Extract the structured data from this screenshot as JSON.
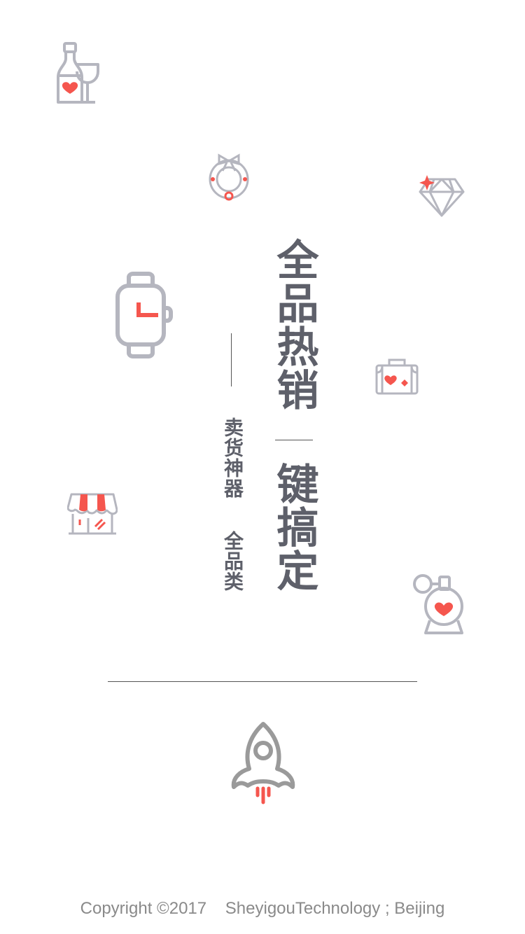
{
  "headline": {
    "part1": "全品热销",
    "part2": "键搞定"
  },
  "subtitle": {
    "part1": "卖货神器",
    "part2": "全品类"
  },
  "footer": {
    "copyright": "Copyright ©2017    SheyigouTechnology ; Beijing"
  },
  "colors": {
    "icon_gray": "#b5b6bf",
    "accent_red": "#f5564e",
    "text_dark": "#5e606a",
    "rocket_gray": "#9a9a9a"
  },
  "icons": [
    "wine-bottle-icon",
    "wreath-icon",
    "diamond-icon",
    "watch-icon",
    "suitcase-icon",
    "storefront-icon",
    "perfume-icon",
    "rocket-icon"
  ]
}
